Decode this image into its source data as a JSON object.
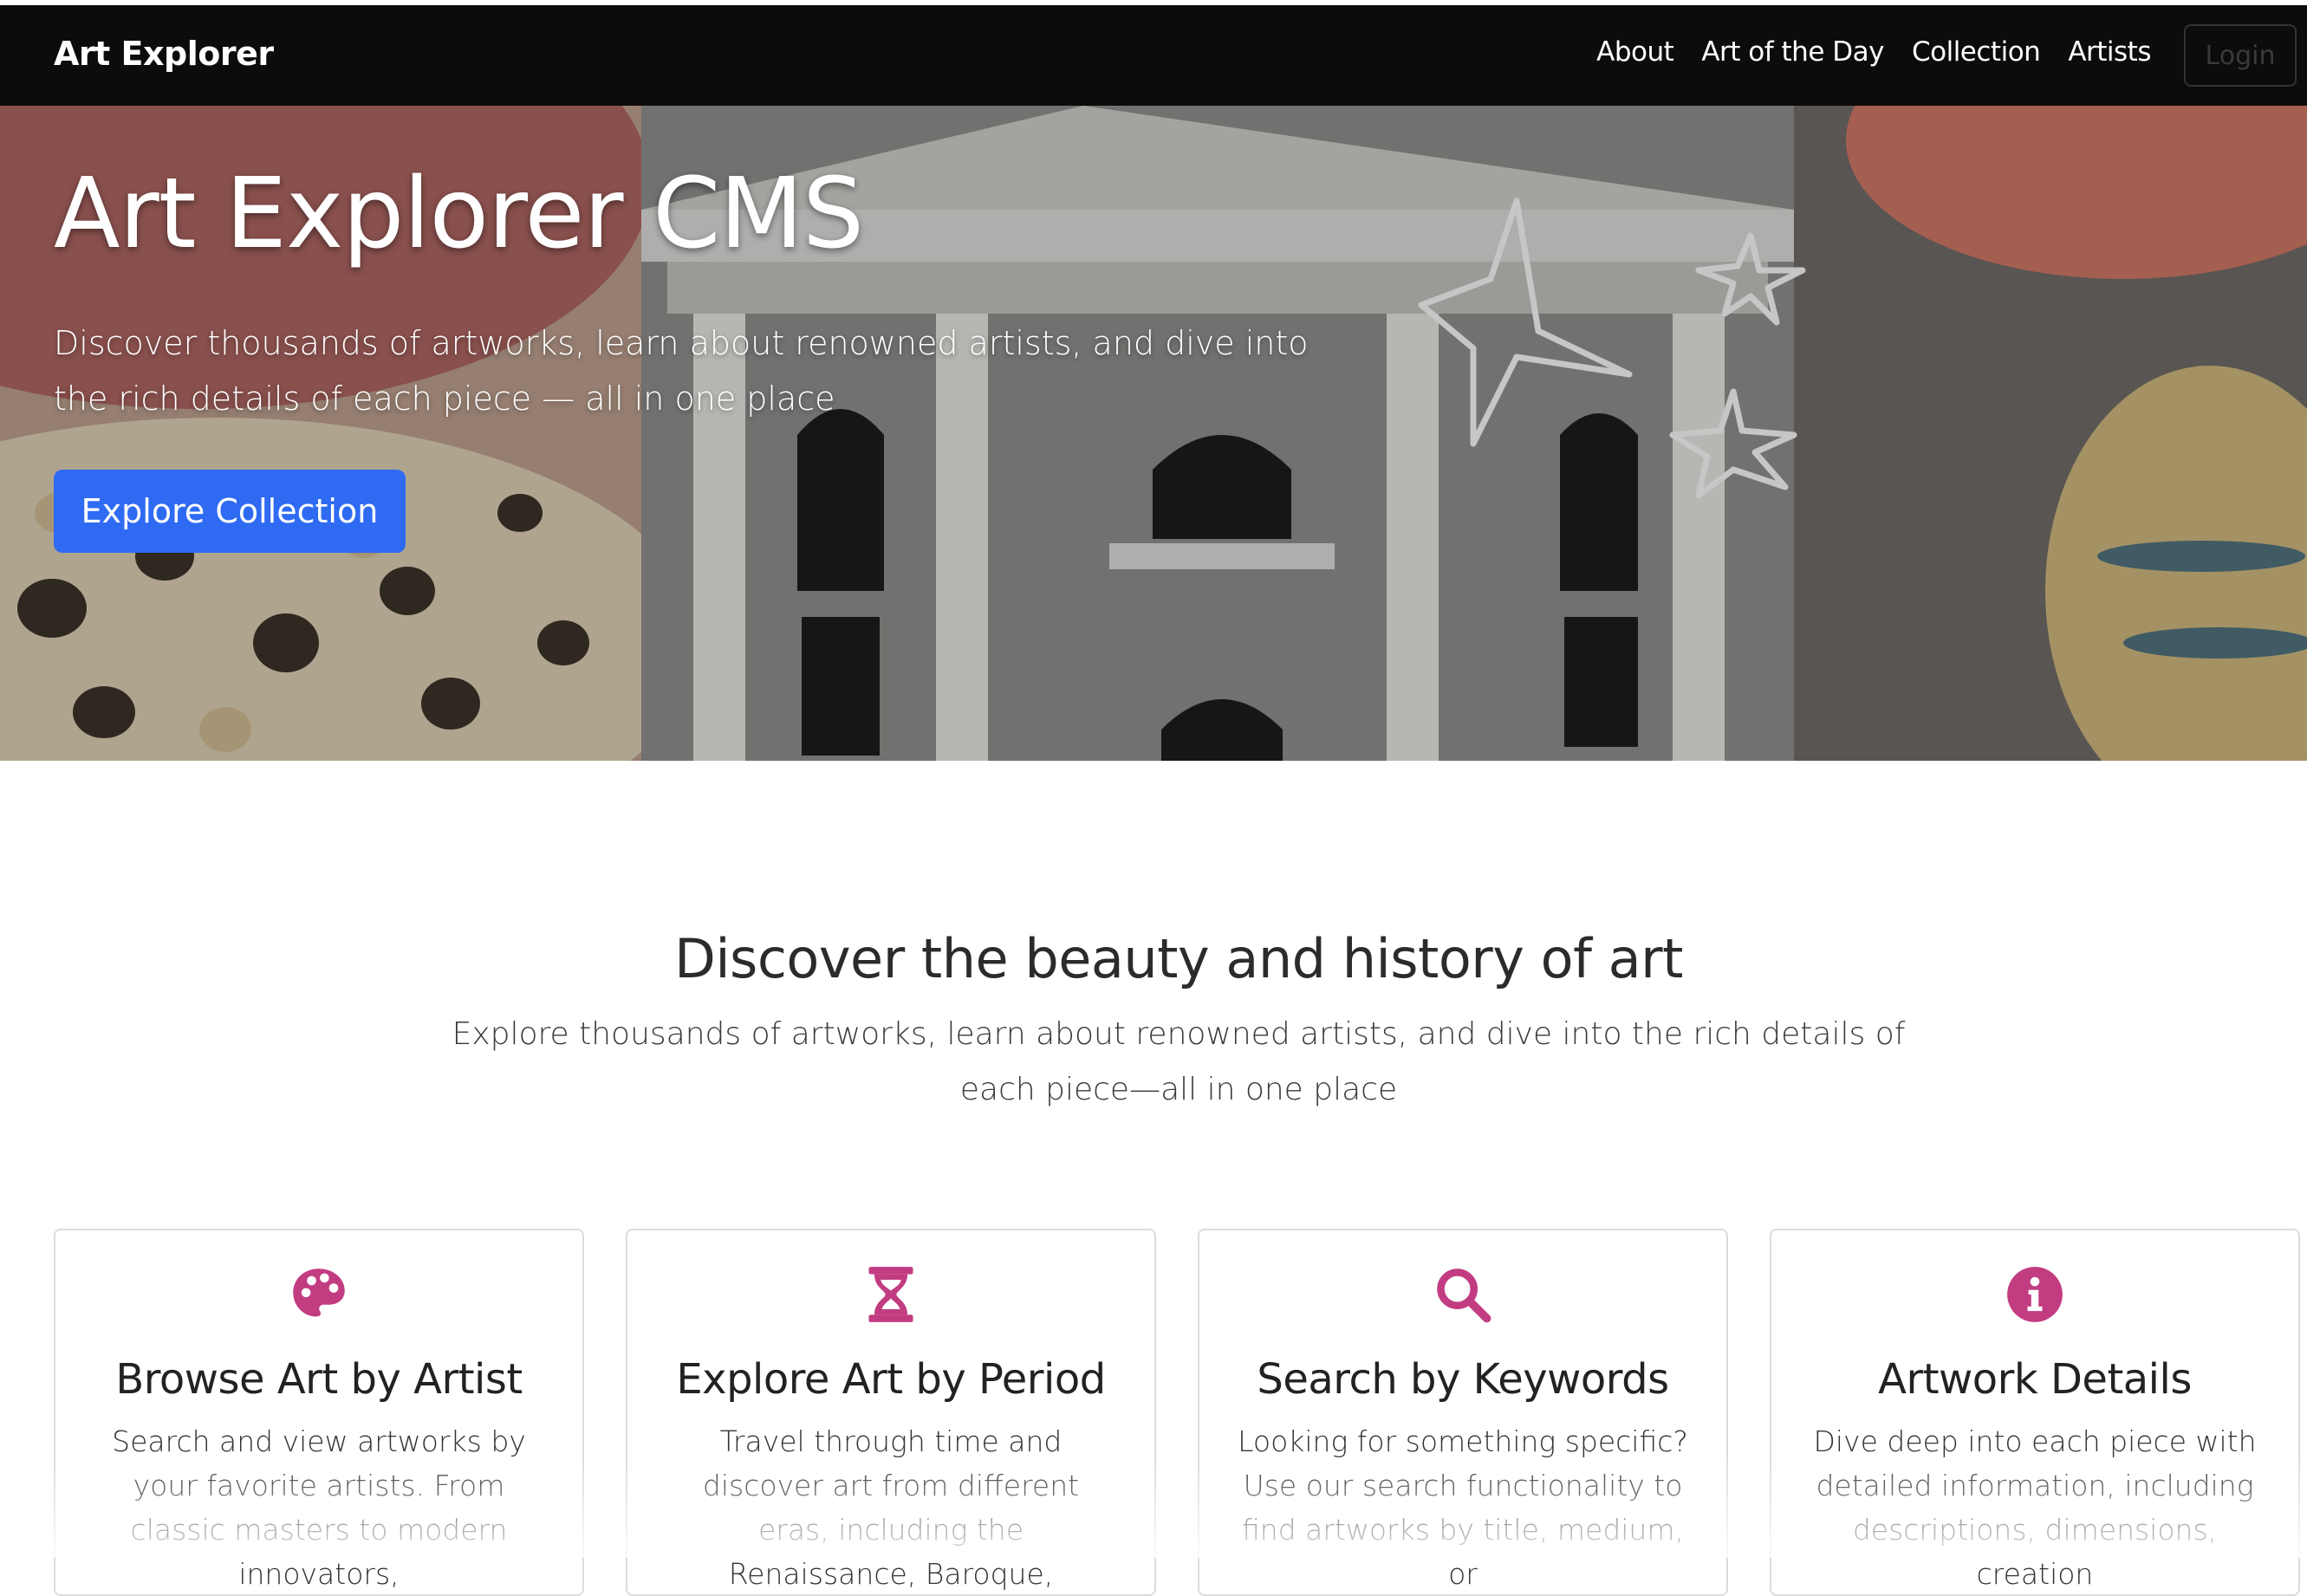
{
  "navbar": {
    "brand": "Art Explorer",
    "links": [
      "About",
      "Art of the Day",
      "Collection",
      "Artists"
    ],
    "login_label": "Login"
  },
  "hero": {
    "title": "Art Explorer CMS",
    "lead": "Discover thousands of artworks, learn about renowned artists, and dive into the rich details of each piece — all in one place",
    "button_label": "Explore Collection"
  },
  "intro": {
    "title": "Discover the beauty and history of art",
    "text": "Explore thousands of artworks, learn about renowned artists, and dive into the rich details of each piece—all in one place"
  },
  "cards": [
    {
      "icon": "palette-icon",
      "title": "Browse Art by Artist",
      "text": "Search and view artworks by your favorite artists. From classic masters to modern innovators,"
    },
    {
      "icon": "hourglass-icon",
      "title": "Explore Art by Period",
      "text": "Travel through time and discover art from different eras, including the Renaissance, Baroque,"
    },
    {
      "icon": "magnifier-icon",
      "title": "Search by Keywords",
      "text": "Looking for something specific? Use our search functionality to find artworks by title, medium, or"
    },
    {
      "icon": "info-icon",
      "title": "Artwork Details",
      "text": "Dive deep into each piece with detailed information, including descriptions, dimensions, creation"
    }
  ],
  "colors": {
    "accent": "#c23c82",
    "primary_button": "#2f6bf2",
    "navbar": "#0d0b0b"
  }
}
